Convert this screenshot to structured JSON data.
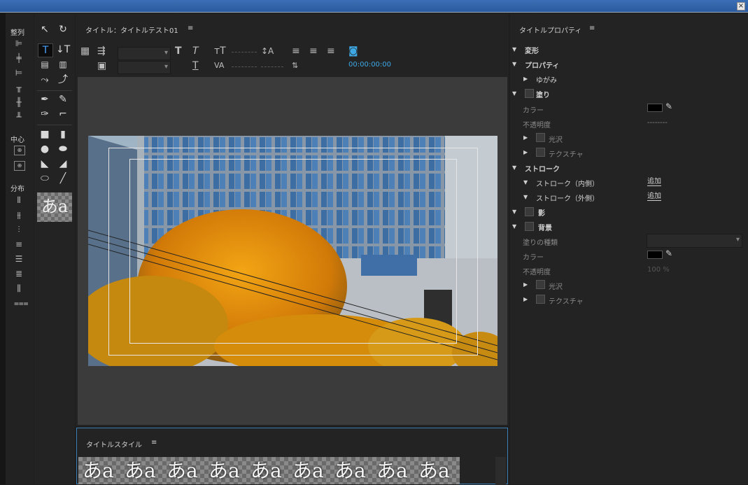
{
  "window": {
    "close_icon": "×"
  },
  "align_panel": {
    "align_label": "整列",
    "center_label": "中心",
    "distribute_label": "分布"
  },
  "tools": {
    "preview_text": "あa"
  },
  "title_panel": {
    "header": "タイトル：タイトルテスト01",
    "menu_icon": "≡",
    "timecode": "00:00:00:00"
  },
  "properties_panel": {
    "header": "タイトルプロパティ",
    "menu_icon": "≡",
    "transform": "変形",
    "properties": "プロパティ",
    "distort": "ゆがみ",
    "fill": "塗り",
    "color": "カラー",
    "opacity": "不透明度",
    "opacity_value_1": "--------",
    "sheen": "光沢",
    "texture": "テクスチャ",
    "strokes": "ストローク",
    "inner_stroke": "ストローク（内側）",
    "outer_stroke": "ストローク（外側）",
    "add_1": "追加",
    "add_2": "追加",
    "shadow": "影",
    "background": "背景",
    "fill_type": "塗りの種類",
    "bg_color": "カラー",
    "bg_opacity": "不透明度",
    "bg_opacity_value": "100 %",
    "bg_sheen": "光沢",
    "bg_texture": "テクスチャ"
  },
  "styles_panel": {
    "header": "タイトルスタイル",
    "menu_icon": "≡",
    "thumbs": [
      "あa",
      "あa",
      "あa",
      "あa",
      "あa",
      "あa",
      "あa",
      "あa",
      "あa"
    ]
  }
}
